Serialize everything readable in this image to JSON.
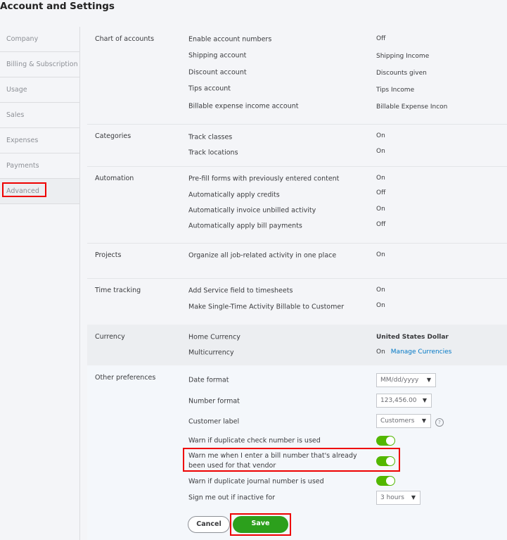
{
  "title": "Account and Settings",
  "sidebar": {
    "items": [
      {
        "label": "Company"
      },
      {
        "label": "Billing & Subscription"
      },
      {
        "label": "Usage"
      },
      {
        "label": "Sales"
      },
      {
        "label": "Expenses"
      },
      {
        "label": "Payments"
      },
      {
        "label": "Advanced",
        "active": true
      }
    ]
  },
  "sections": {
    "chart_of_accounts": {
      "label": "Chart of accounts",
      "rows": [
        {
          "label": "Enable account numbers",
          "value": "Off"
        },
        {
          "label": "Shipping account",
          "value": "Shipping Income"
        },
        {
          "label": "Discount account",
          "value": "Discounts given"
        },
        {
          "label": "Tips account",
          "value": "Tips Income"
        },
        {
          "label": "Billable expense income account",
          "value": "Billable Expense Incon"
        }
      ]
    },
    "categories": {
      "label": "Categories",
      "rows": [
        {
          "label": "Track classes",
          "value": "On"
        },
        {
          "label": "Track locations",
          "value": "On"
        }
      ]
    },
    "automation": {
      "label": "Automation",
      "rows": [
        {
          "label": "Pre-fill forms with previously entered content",
          "value": "On"
        },
        {
          "label": "Automatically apply credits",
          "value": "Off"
        },
        {
          "label": "Automatically invoice unbilled activity",
          "value": "On"
        },
        {
          "label": "Automatically apply bill payments",
          "value": "Off"
        }
      ]
    },
    "projects": {
      "label": "Projects",
      "rows": [
        {
          "label": "Organize all job-related activity in one place",
          "value": "On"
        }
      ]
    },
    "time_tracking": {
      "label": "Time tracking",
      "rows": [
        {
          "label": "Add Service field to timesheets",
          "value": "On"
        },
        {
          "label": "Make Single-Time Activity Billable to Customer",
          "value": "On"
        }
      ]
    },
    "currency": {
      "label": "Currency",
      "rows": [
        {
          "label": "Home Currency",
          "value": "United States Dollar"
        },
        {
          "label": "Multicurrency",
          "value": "On",
          "link": "Manage Currencies"
        }
      ]
    },
    "other": {
      "label": "Other preferences",
      "date_format": {
        "label": "Date format",
        "value": "MM/dd/yyyy"
      },
      "number_format": {
        "label": "Number format",
        "value": "123,456.00"
      },
      "customer_label": {
        "label": "Customer label",
        "value": "Customers",
        "help": "?"
      },
      "warn_check": {
        "label": "Warn if duplicate check number is used",
        "on": true
      },
      "warn_bill": {
        "label_line1": "Warn me when I enter a bill number that's already",
        "label_line2": "been used for that vendor",
        "on": true
      },
      "warn_journal": {
        "label": "Warn if duplicate journal number is used",
        "on": true
      },
      "sign_out": {
        "label": "Sign me out if inactive for",
        "value": "3 hours"
      }
    }
  },
  "buttons": {
    "cancel": "Cancel",
    "save": "Save"
  },
  "colors": {
    "toggle_on": "#53b700",
    "save": "#2ca01c",
    "link": "#0077c5",
    "highlight": "#ee0000"
  }
}
